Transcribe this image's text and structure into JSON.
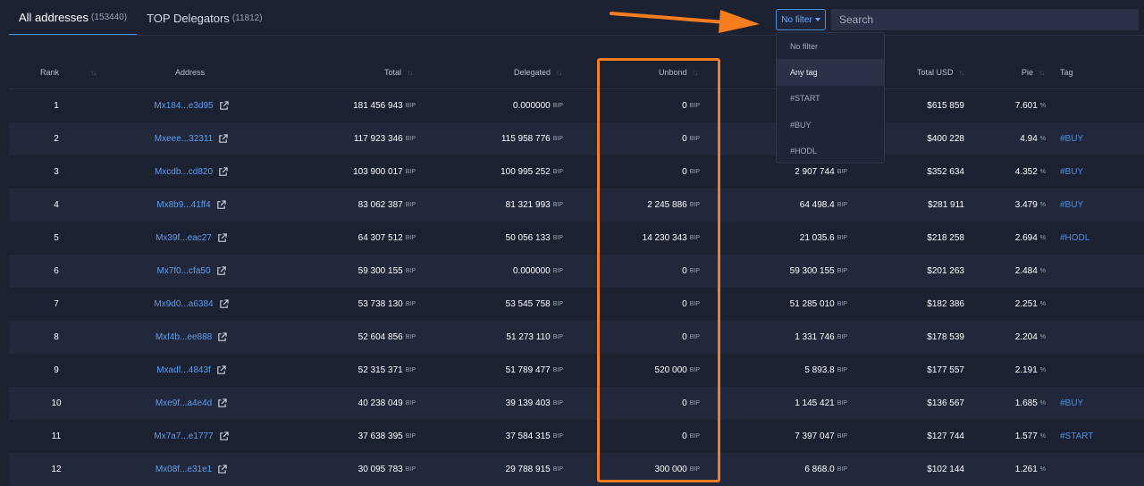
{
  "tabs": [
    {
      "label": "All addresses",
      "count": "(153440)"
    },
    {
      "label": "TOP Delegators",
      "count": "(11812)"
    }
  ],
  "filter": {
    "label": "No filter"
  },
  "search": {
    "placeholder": "Search"
  },
  "dropdown": {
    "items": [
      "No filter",
      "Any tag",
      "#START",
      "#BUY",
      "#HODL"
    ],
    "selected": "Any tag"
  },
  "columns": {
    "rank": "Rank",
    "address": "Address",
    "total": "Total",
    "delegated": "Delegated",
    "unbond": "Unbond",
    "total_usd": "Total USD",
    "pie": "Pie",
    "tag": "Tag"
  },
  "unit": "BIP",
  "pct": "%",
  "rows": [
    {
      "rank": "1",
      "address": "Mx184...e3d95",
      "total": "181 456 943",
      "delegated": "0.000000",
      "unbond": "0",
      "stake": "",
      "usd": "$615 859",
      "pie": "7.601",
      "tag": ""
    },
    {
      "rank": "2",
      "address": "Mxeee...32311",
      "total": "117 923 346",
      "delegated": "115 958 776",
      "unbond": "0",
      "stake": "",
      "usd": "$400 228",
      "pie": "4.94",
      "tag": "#BUY"
    },
    {
      "rank": "3",
      "address": "Mxcdb...cd820",
      "total": "103 900 017",
      "delegated": "100 995 252",
      "unbond": "0",
      "stake": "2 907 744",
      "usd": "$352 634",
      "pie": "4.352",
      "tag": "#BUY"
    },
    {
      "rank": "4",
      "address": "Mx8b9...41ff4",
      "total": "83 062 387",
      "delegated": "81 321 993",
      "unbond": "2 245 886",
      "stake": "64 498.4",
      "usd": "$281 911",
      "pie": "3.479",
      "tag": "#BUY"
    },
    {
      "rank": "5",
      "address": "Mx39f...eac27",
      "total": "64 307 512",
      "delegated": "50 056 133",
      "unbond": "14 230 343",
      "stake": "21 035.6",
      "usd": "$218 258",
      "pie": "2.694",
      "tag": "#HODL"
    },
    {
      "rank": "6",
      "address": "Mx7f0...cfa50",
      "total": "59 300 155",
      "delegated": "0.000000",
      "unbond": "0",
      "stake": "59 300 155",
      "usd": "$201 263",
      "pie": "2.484",
      "tag": ""
    },
    {
      "rank": "7",
      "address": "Mx9d0...a6384",
      "total": "53 738 130",
      "delegated": "53 545 758",
      "unbond": "0",
      "stake": "51 285 010",
      "usd": "$182 386",
      "pie": "2.251",
      "tag": ""
    },
    {
      "rank": "8",
      "address": "Mxf4b...ee888",
      "total": "52 604 856",
      "delegated": "51 273 110",
      "unbond": "0",
      "stake": "1 331 746",
      "usd": "$178 539",
      "pie": "2.204",
      "tag": ""
    },
    {
      "rank": "9",
      "address": "Mxadf...4843f",
      "total": "52 315 371",
      "delegated": "51 789 477",
      "unbond": "520 000",
      "stake": "5 893.8",
      "usd": "$177 557",
      "pie": "2.191",
      "tag": ""
    },
    {
      "rank": "10",
      "address": "Mxe9f...a4e4d",
      "total": "40 238 049",
      "delegated": "39 139 403",
      "unbond": "0",
      "stake": "1 145 421",
      "usd": "$136 567",
      "pie": "1.685",
      "tag": "#BUY"
    },
    {
      "rank": "11",
      "address": "Mx7a7...e1777",
      "total": "37 638 395",
      "delegated": "37 584 315",
      "unbond": "0",
      "stake": "7 397 047",
      "usd": "$127 744",
      "pie": "1.577",
      "tag": "#START"
    },
    {
      "rank": "12",
      "address": "Mx08f...e31e1",
      "total": "30 095 783",
      "delegated": "29 788 915",
      "unbond": "300 000",
      "stake": "6 868.0",
      "usd": "$102 144",
      "pie": "1.261",
      "tag": ""
    }
  ],
  "colors": {
    "accent": "#4a90e2",
    "annotation": "#f57c1f",
    "background": "#1c2132"
  }
}
